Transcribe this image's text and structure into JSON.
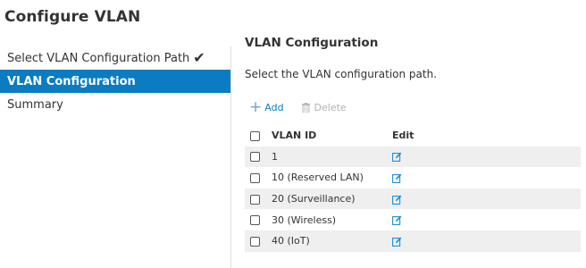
{
  "page": {
    "title": "Configure VLAN"
  },
  "steps": [
    {
      "label": "Select VLAN Configuration Path",
      "completed": true,
      "active": false
    },
    {
      "label": "VLAN Configuration",
      "completed": false,
      "active": true
    },
    {
      "label": "Summary",
      "completed": false,
      "active": false
    }
  ],
  "main": {
    "title": "VLAN Configuration",
    "description": "Select the VLAN configuration path."
  },
  "toolbar": {
    "add_label": "Add",
    "delete_label": "Delete"
  },
  "table": {
    "columns": [
      "VLAN ID",
      "Edit"
    ],
    "rows": [
      {
        "vlan_id": "1"
      },
      {
        "vlan_id": "10 (Reserved LAN)"
      },
      {
        "vlan_id": "20 (Surveillance)"
      },
      {
        "vlan_id": "30 (Wireless)"
      },
      {
        "vlan_id": "40 (IoT)"
      }
    ]
  },
  "colors": {
    "accent": "#0b7bc2",
    "row_stripe": "#efefef",
    "edit_icon": "#1a8fd6"
  }
}
